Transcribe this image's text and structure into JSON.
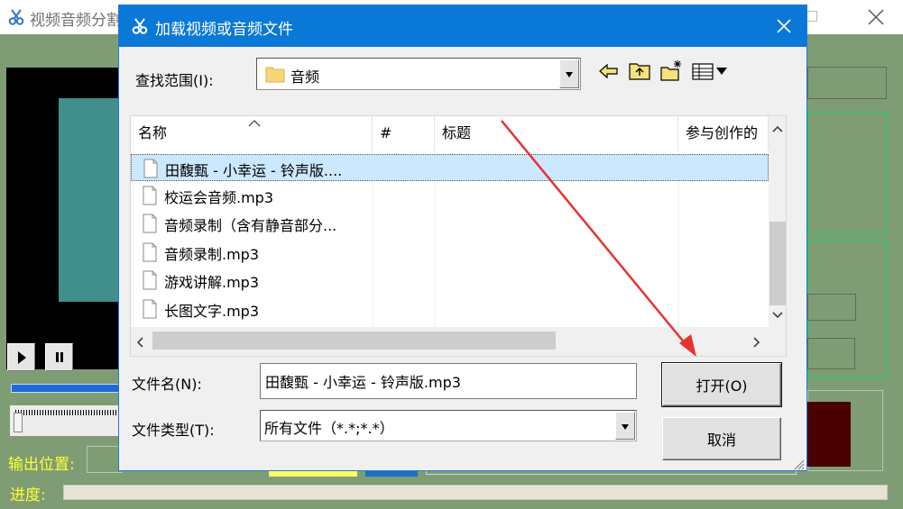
{
  "app": {
    "title": "视频音频分割",
    "output_label": "输出位置:",
    "progress_label": "进度:"
  },
  "dialog": {
    "title": "加载视频或音频文件",
    "look_in_label": "查找范围(I):",
    "look_in_value": "音频",
    "columns": [
      "名称",
      "#",
      "标题",
      "参与创作的"
    ],
    "files": [
      {
        "name": "田馥甄 - 小幸运 - 铃声版....",
        "selected": true
      },
      {
        "name": "校运会音频.mp3",
        "selected": false
      },
      {
        "name": "音频录制（含有静音部分...",
        "selected": false
      },
      {
        "name": "音频录制.mp3",
        "selected": false
      },
      {
        "name": "游戏讲解.mp3",
        "selected": false
      },
      {
        "name": "长图文字.mp3",
        "selected": false
      }
    ],
    "filename_label": "文件名(N):",
    "filename_value": "田馥甄 - 小幸运 - 铃声版.mp3",
    "filetype_label": "文件类型(T):",
    "filetype_value": "所有文件（*.*;*.*）",
    "open_button": "打开(O)",
    "cancel_button": "取消"
  },
  "colors": {
    "title_bar": "#0a78d7",
    "app_background": "#7f9d75",
    "app_label": "#ffff33",
    "selection": "#cce8ff",
    "annotation_arrow": "#e8322f"
  },
  "icons": [
    "scissors-icon",
    "close-icon",
    "folder-icon",
    "back-arrow-icon",
    "up-folder-icon",
    "new-folder-icon",
    "view-menu-icon",
    "file-icon"
  ]
}
